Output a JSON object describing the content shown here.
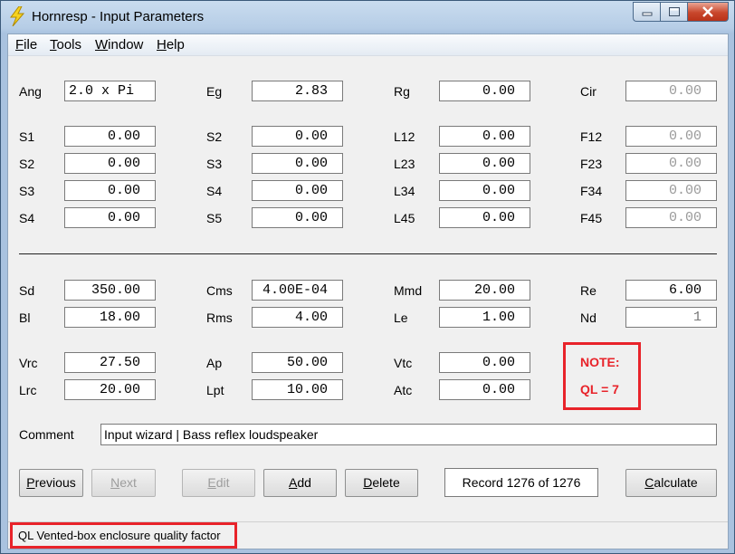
{
  "window": {
    "title": "Hornresp - Input Parameters"
  },
  "menu": [
    {
      "pre": "",
      "u": "F",
      "post": "ile"
    },
    {
      "pre": "",
      "u": "T",
      "post": "ools"
    },
    {
      "pre": "",
      "u": "W",
      "post": "indow"
    },
    {
      "pre": "",
      "u": "H",
      "post": "elp"
    }
  ],
  "params": {
    "ang": {
      "label": "Ang",
      "value": "2.0 x Pi"
    },
    "eg": {
      "label": "Eg",
      "value": "2.83"
    },
    "rg": {
      "label": "Rg",
      "value": "0.00"
    },
    "cir": {
      "label": "Cir",
      "value": "0.00"
    },
    "s1": {
      "label": "S1",
      "value": "0.00"
    },
    "s2a": {
      "label": "S2",
      "value": "0.00"
    },
    "s3a": {
      "label": "S3",
      "value": "0.00"
    },
    "s4a": {
      "label": "S4",
      "value": "0.00"
    },
    "s2b": {
      "label": "S2",
      "value": "0.00"
    },
    "s3b": {
      "label": "S3",
      "value": "0.00"
    },
    "s4b": {
      "label": "S4",
      "value": "0.00"
    },
    "s5": {
      "label": "S5",
      "value": "0.00"
    },
    "l12": {
      "label": "L12",
      "value": "0.00"
    },
    "l23": {
      "label": "L23",
      "value": "0.00"
    },
    "l34": {
      "label": "L34",
      "value": "0.00"
    },
    "l45": {
      "label": "L45",
      "value": "0.00"
    },
    "f12": {
      "label": "F12",
      "value": "0.00"
    },
    "f23": {
      "label": "F23",
      "value": "0.00"
    },
    "f34": {
      "label": "F34",
      "value": "0.00"
    },
    "f45": {
      "label": "F45",
      "value": "0.00"
    },
    "sd": {
      "label": "Sd",
      "value": "350.00"
    },
    "bl": {
      "label": "Bl",
      "value": "18.00"
    },
    "cms": {
      "label": "Cms",
      "value": "4.00E-04"
    },
    "rms": {
      "label": "Rms",
      "value": "4.00"
    },
    "mmd": {
      "label": "Mmd",
      "value": "20.00"
    },
    "le": {
      "label": "Le",
      "value": "1.00"
    },
    "re": {
      "label": "Re",
      "value": "6.00"
    },
    "nd": {
      "label": "Nd",
      "value": "1"
    },
    "vrc": {
      "label": "Vrc",
      "value": "27.50"
    },
    "lrc": {
      "label": "Lrc",
      "value": "20.00"
    },
    "ap": {
      "label": "Ap",
      "value": "50.00"
    },
    "lpt": {
      "label": "Lpt",
      "value": "10.00"
    },
    "vtc": {
      "label": "Vtc",
      "value": "0.00"
    },
    "atc": {
      "label": "Atc",
      "value": "0.00"
    }
  },
  "note": {
    "title": "NOTE:",
    "text": "QL = 7"
  },
  "comment": {
    "label": "Comment",
    "value": "Input wizard | Bass reflex loudspeaker"
  },
  "buttons": {
    "previous": {
      "pre": "",
      "u": "P",
      "post": "revious"
    },
    "next": {
      "pre": "",
      "u": "N",
      "post": "ext"
    },
    "edit": {
      "pre": "",
      "u": "E",
      "post": "dit"
    },
    "add": {
      "pre": "",
      "u": "A",
      "post": "dd"
    },
    "delete": {
      "pre": "",
      "u": "D",
      "post": "elete"
    },
    "calculate": {
      "pre": "",
      "u": "C",
      "post": "alculate"
    }
  },
  "record": "Record 1276 of 1276",
  "status": "QL  Vented-box enclosure quality factor",
  "colors": {
    "highlight": "#e8232a",
    "client": "#f0f0f0",
    "titlebar": "#b6cde6"
  }
}
